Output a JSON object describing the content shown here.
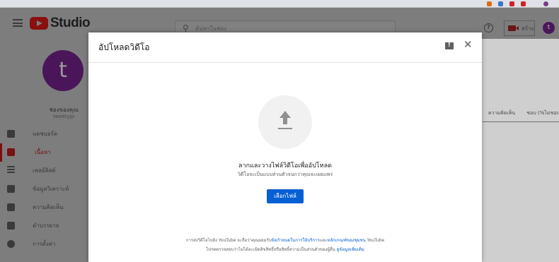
{
  "modal": {
    "title": "อัปโหลดวิดีโอ",
    "drag_text": "ลากและวางไฟล์วิดีโอเพื่ออัปโหลด",
    "private_text": "วิดีโอจะเป็นแบบส่วนตัวจนกว่าคุณจะเผยแพร่",
    "select_button": "เลือกไฟล์",
    "terms_prefix": "การส่งวิดีโอไปยัง YouTube จะถือว่าคุณยอมรับ",
    "terms_link_1": "ข้อกำหนดในการให้บริการ",
    "terms_and": "และ",
    "terms_link_2": "หลักเกณฑ์ของชุมชน",
    "terms_suffix": " YouTube",
    "copyright_text": "โปรดตรวจสอบว่าไม่ได้ละเมิดลิขสิทธิ์หรือสิทธิ์ความเป็นส่วนตัวของผู้อื่น ",
    "copyright_link": "ดูข้อมูลเพิ่มเติม"
  },
  "header": {
    "logo_text": "Studio",
    "search_placeholder": "ค้นหาในช่อง",
    "create_label": "สร้าง",
    "avatar_letter": "t"
  },
  "sidebar": {
    "channel_avatar": "t",
    "channel_label": "ช่องของคุณ",
    "channel_handle": "tweetyjp",
    "items": [
      {
        "label": "แดชบอร์ด",
        "icon": "dashboard-icon"
      },
      {
        "label": "เนื้อหา",
        "icon": "content-icon"
      },
      {
        "label": "เพลย์ลิสต์",
        "icon": "playlist-icon"
      },
      {
        "label": "ข้อมูลวิเคราะห์",
        "icon": "analytics-icon"
      },
      {
        "label": "ความคิดเห็น",
        "icon": "comments-icon"
      },
      {
        "label": "คำบรรยาย",
        "icon": "subtitles-icon"
      },
      {
        "label": "การตั้งค่า",
        "icon": "settings-icon"
      }
    ]
  },
  "background": {
    "col_comments": "ความคิดเห็น",
    "col_likes": "ชอบ (%ไม่ชอบ)"
  },
  "colors": {
    "accent_blue": "#065fd4",
    "youtube_red": "#ff0000",
    "avatar_purple": "#6f1d86"
  }
}
